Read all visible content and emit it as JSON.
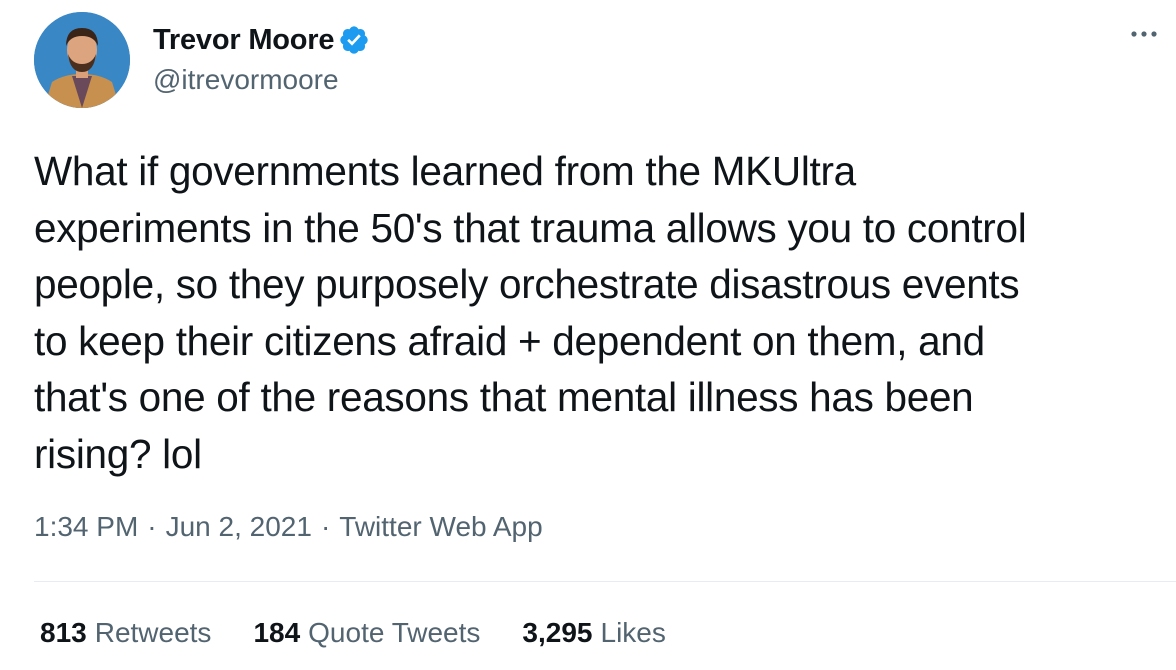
{
  "author": {
    "display_name": "Trevor Moore",
    "handle": "@itrevormoore",
    "verified": true,
    "avatar_icon": "user-avatar"
  },
  "more_icon": "more-horizontal-icon",
  "tweet": {
    "lines": [
      "What if governments learned from the MKUltra",
      "experiments in the 50's that trauma allows you to control",
      "people, so they purposely orchestrate disastrous events",
      "to keep their citizens afraid + dependent on them, and",
      "that's one of the reasons that mental illness has been",
      "rising? lol"
    ]
  },
  "meta": {
    "time": "1:34 PM",
    "separator": "·",
    "date": "Jun 2, 2021",
    "source": "Twitter Web App"
  },
  "stats": {
    "retweets": {
      "count": "813",
      "label": "Retweets"
    },
    "quote_tweets": {
      "count": "184",
      "label": "Quote Tweets"
    },
    "likes": {
      "count": "3,295",
      "label": "Likes"
    }
  },
  "colors": {
    "text_primary": "#0f1419",
    "text_secondary": "#536471",
    "verified_blue": "#1d9bf0",
    "divider": "#e6ecf0"
  }
}
